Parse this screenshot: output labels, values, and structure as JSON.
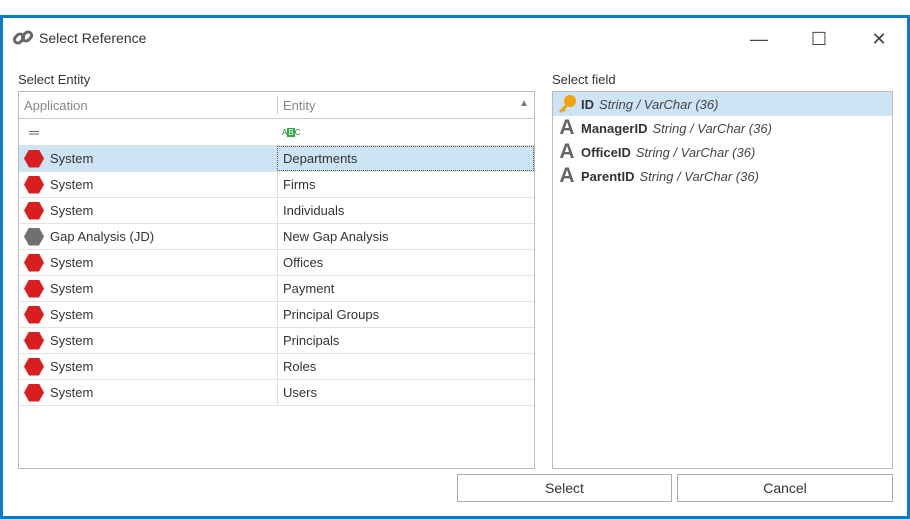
{
  "window": {
    "title": "Select Reference",
    "minimize": "—",
    "maximize": "☐",
    "close": "✕"
  },
  "entity": {
    "label": "Select Entity",
    "columns": [
      "Application",
      "Entity"
    ],
    "rows": [
      {
        "app": "System",
        "entity": "Departments",
        "color": "#d81e1e",
        "selected": true
      },
      {
        "app": "System",
        "entity": "Firms",
        "color": "#d81e1e"
      },
      {
        "app": "System",
        "entity": "Individuals",
        "color": "#d81e1e"
      },
      {
        "app": "Gap Analysis (JD)",
        "entity": "New Gap Analysis",
        "color": "#707070"
      },
      {
        "app": "System",
        "entity": "Offices",
        "color": "#d81e1e"
      },
      {
        "app": "System",
        "entity": "Payment",
        "color": "#d81e1e"
      },
      {
        "app": "System",
        "entity": "Principal Groups",
        "color": "#d81e1e"
      },
      {
        "app": "System",
        "entity": "Principals",
        "color": "#d81e1e"
      },
      {
        "app": "System",
        "entity": "Roles",
        "color": "#d81e1e"
      },
      {
        "app": "System",
        "entity": "Users",
        "color": "#d81e1e"
      }
    ]
  },
  "field": {
    "label": "Select field",
    "items": [
      {
        "name": "ID",
        "type": "String / VarChar (36)",
        "icon": "key-icon",
        "selected": true
      },
      {
        "name": "ManagerID",
        "type": "String / VarChar (36)",
        "icon": "text-a-icon"
      },
      {
        "name": "OfficeID",
        "type": "String / VarChar (36)",
        "icon": "text-a-icon"
      },
      {
        "name": "ParentID",
        "type": "String / VarChar (36)",
        "icon": "text-a-icon"
      }
    ]
  },
  "buttons": {
    "select": "Select",
    "cancel": "Cancel"
  }
}
